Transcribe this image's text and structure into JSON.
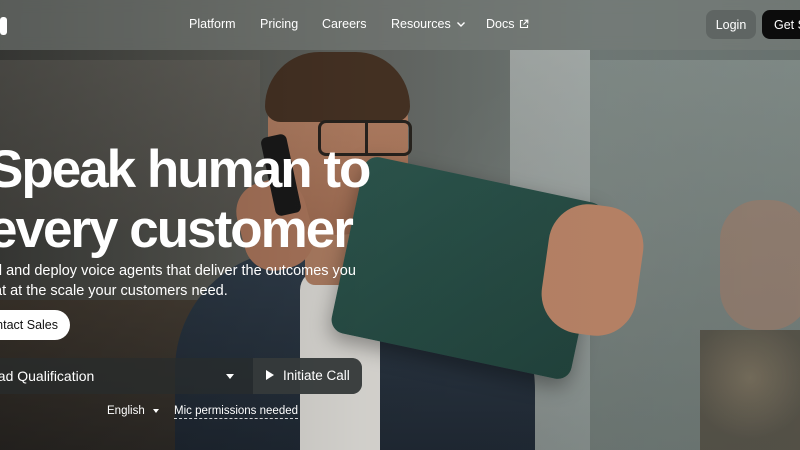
{
  "header": {
    "nav": [
      {
        "label": "Platform"
      },
      {
        "label": "Pricing"
      },
      {
        "label": "Careers"
      },
      {
        "label": "Resources",
        "icon": "chevron-down-icon"
      },
      {
        "label": "Docs",
        "icon": "external-link-icon"
      }
    ],
    "login_label": "Login",
    "get_started_label": "Get S"
  },
  "hero": {
    "headline_line1": "Speak human to",
    "headline_line2": "every customer",
    "subtext_line1": "d and deploy voice agents that deliver the outcomes you",
    "subtext_line2": "at at the scale your customers need.",
    "contact_label": "ontact Sales"
  },
  "demo": {
    "use_case_selected": "ead Qualification",
    "call_label": "Initiate Call",
    "language_selected": "English",
    "mic_note": "Mic permissions needed"
  }
}
